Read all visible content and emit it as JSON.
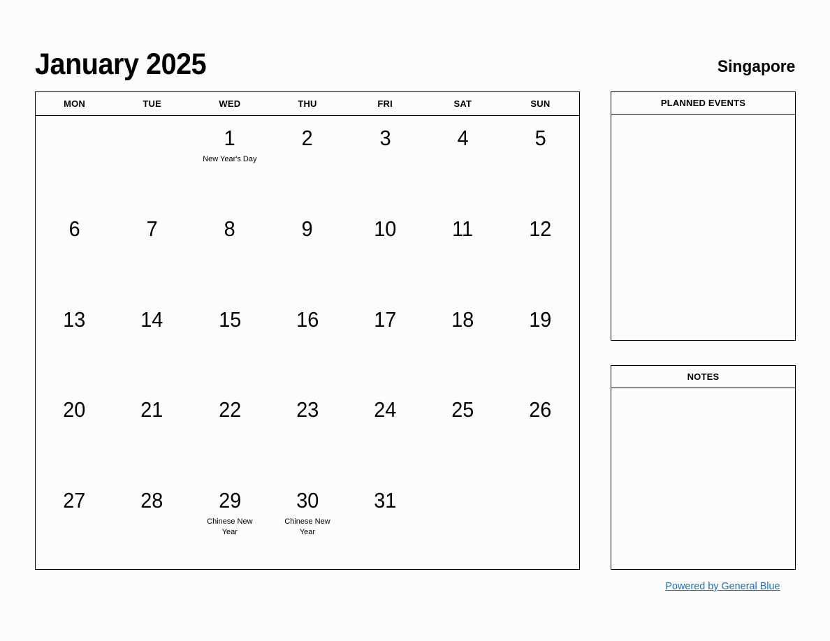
{
  "header": {
    "title": "January 2025",
    "country": "Singapore"
  },
  "calendar": {
    "weekdays": [
      "MON",
      "TUE",
      "WED",
      "THU",
      "FRI",
      "SAT",
      "SUN"
    ],
    "weeks": [
      [
        {
          "num": "",
          "event": ""
        },
        {
          "num": "",
          "event": ""
        },
        {
          "num": "1",
          "event": "New Year's Day"
        },
        {
          "num": "2",
          "event": ""
        },
        {
          "num": "3",
          "event": ""
        },
        {
          "num": "4",
          "event": ""
        },
        {
          "num": "5",
          "event": ""
        }
      ],
      [
        {
          "num": "6",
          "event": ""
        },
        {
          "num": "7",
          "event": ""
        },
        {
          "num": "8",
          "event": ""
        },
        {
          "num": "9",
          "event": ""
        },
        {
          "num": "10",
          "event": ""
        },
        {
          "num": "11",
          "event": ""
        },
        {
          "num": "12",
          "event": ""
        }
      ],
      [
        {
          "num": "13",
          "event": ""
        },
        {
          "num": "14",
          "event": ""
        },
        {
          "num": "15",
          "event": ""
        },
        {
          "num": "16",
          "event": ""
        },
        {
          "num": "17",
          "event": ""
        },
        {
          "num": "18",
          "event": ""
        },
        {
          "num": "19",
          "event": ""
        }
      ],
      [
        {
          "num": "20",
          "event": ""
        },
        {
          "num": "21",
          "event": ""
        },
        {
          "num": "22",
          "event": ""
        },
        {
          "num": "23",
          "event": ""
        },
        {
          "num": "24",
          "event": ""
        },
        {
          "num": "25",
          "event": ""
        },
        {
          "num": "26",
          "event": ""
        }
      ],
      [
        {
          "num": "27",
          "event": ""
        },
        {
          "num": "28",
          "event": ""
        },
        {
          "num": "29",
          "event": "Chinese New Year"
        },
        {
          "num": "30",
          "event": "Chinese New Year"
        },
        {
          "num": "31",
          "event": ""
        },
        {
          "num": "",
          "event": ""
        },
        {
          "num": "",
          "event": ""
        }
      ]
    ]
  },
  "panels": {
    "planned_events": {
      "title": "PLANNED EVENTS",
      "content": ""
    },
    "notes": {
      "title": "NOTES",
      "content": ""
    }
  },
  "footer": {
    "link_label": "Powered by General Blue"
  },
  "colors": {
    "link": "#1a6fc4",
    "border": "#000000",
    "background": "#fcfcfb"
  }
}
